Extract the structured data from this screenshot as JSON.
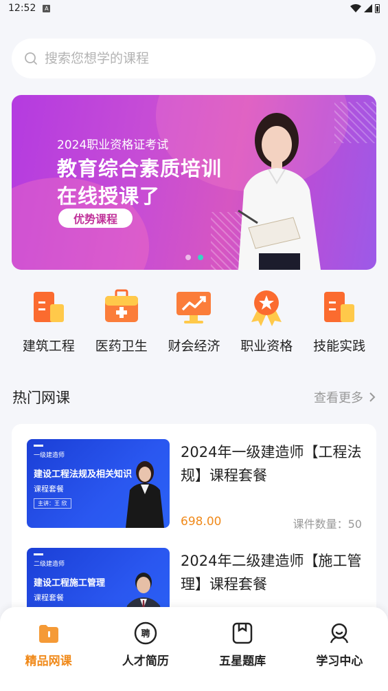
{
  "status_bar": {
    "time": "12:52",
    "notification_icon": "A"
  },
  "search": {
    "placeholder": "搜索您想学的课程",
    "icon": "search-icon"
  },
  "banner": {
    "subtitle": "2024职业资格证考试",
    "title_line1": "教育综合素质培训",
    "title_line2": "在线授课了",
    "tag": "优势课程",
    "page_count": 2,
    "active_page": 2
  },
  "categories": [
    {
      "label": "建筑工程",
      "icon": "building-icon"
    },
    {
      "label": "医药卫生",
      "icon": "medical-kit-icon"
    },
    {
      "label": "财会经济",
      "icon": "finance-chart-icon"
    },
    {
      "label": "职业资格",
      "icon": "award-badge-icon"
    },
    {
      "label": "技能实践",
      "icon": "skill-building-icon"
    }
  ],
  "hot_courses": {
    "title": "热门网课",
    "more": "查看更多",
    "items": [
      {
        "title": "2024年一级建造师【工程法规】课程套餐",
        "price": "698.00",
        "count": "课件数量：50",
        "thumb_small": "一级建造师",
        "thumb_big": "建设工程法规及相关知识",
        "thumb_sub": "课程套餐",
        "thumb_lecturer": "主讲：王 欣"
      },
      {
        "title": "2024年二级建造师【施工管理】课程套餐",
        "thumb_small": "二级建造师",
        "thumb_big": "建设工程施工管理",
        "thumb_sub": "课程套餐"
      }
    ]
  },
  "tabbar": [
    {
      "label": "精品网课",
      "icon": "course-icon",
      "active": true
    },
    {
      "label": "人才简历",
      "icon": "recruit-icon",
      "icon_text": "聘",
      "active": false
    },
    {
      "label": "五星题库",
      "icon": "question-bank-icon",
      "active": false
    },
    {
      "label": "学习中心",
      "icon": "learning-center-icon",
      "active": false
    }
  ],
  "colors": {
    "accent": "#f08a1b",
    "banner_start": "#b43be0",
    "thumb_blue": "#2a57f0"
  }
}
